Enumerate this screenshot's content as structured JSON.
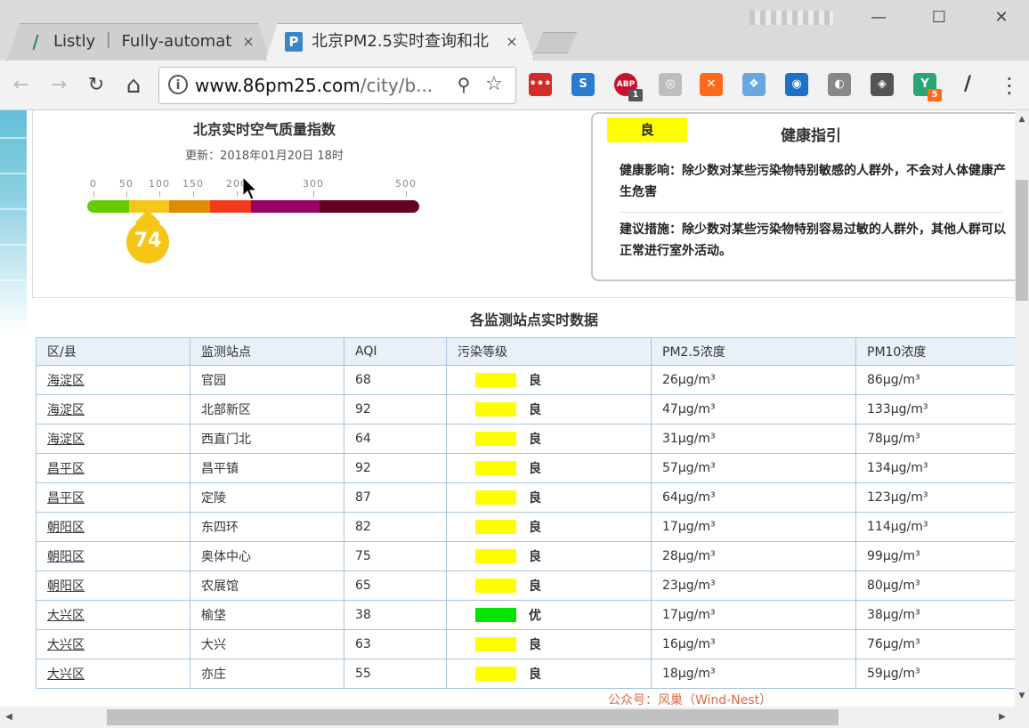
{
  "tabs": [
    {
      "title": "Listly ｜ Fully-automate",
      "favicon": "listly-icon",
      "close": "×"
    },
    {
      "title": "北京PM2.5实时查询和北",
      "favicon": "pm25-site-icon",
      "close": "×"
    }
  ],
  "window": {
    "minimize": "—",
    "maximize": "☐",
    "close": "✕"
  },
  "toolbar": {
    "back": "←",
    "forward": "→",
    "reload": "↻",
    "home": "⌂",
    "url_host": "www.86pm25.com",
    "url_path": "/city/b...",
    "info_icon": "i",
    "zoom_icon": "⚲",
    "bookmark_icon": "☆",
    "menu": "⋮",
    "extensions": [
      {
        "name": "lastpass-icon",
        "glyph": "•••",
        "color": "#d32d27",
        "badge": ""
      },
      {
        "name": "s-extension-icon",
        "glyph": "S",
        "color": "#2b7bd3",
        "badge": ""
      },
      {
        "name": "adblock-plus-icon",
        "glyph": "ABP",
        "color": "#c8102e",
        "badge": "1"
      },
      {
        "name": "weibo-icon",
        "glyph": "◎",
        "color": "#bdbdbd",
        "badge": ""
      },
      {
        "name": "tools-icon",
        "glyph": "✕",
        "color": "#ff6a1a",
        "badge": ""
      },
      {
        "name": "puzzle-icon",
        "glyph": "❖",
        "color": "#6aa6e0",
        "badge": ""
      },
      {
        "name": "circle-icon",
        "glyph": "◉",
        "color": "#1a73c9",
        "badge": ""
      },
      {
        "name": "moon-icon",
        "glyph": "◐",
        "color": "#888888",
        "badge": ""
      },
      {
        "name": "shield-dark-icon",
        "glyph": "◈",
        "color": "#555555",
        "badge": ""
      },
      {
        "name": "y-extension-icon",
        "glyph": "Y",
        "color": "#2aa676",
        "badge": "5"
      },
      {
        "name": "listly-ext-icon",
        "glyph": "/",
        "color": "#f2f2f2",
        "badge": ""
      }
    ]
  },
  "aqi": {
    "title": "北京实时空气质量指数",
    "updated": "更新：2018年01月20日 18时",
    "value": "74",
    "scale_ticks": [
      "0",
      "50",
      "100",
      "150",
      "200",
      "300",
      "500"
    ],
    "scale_colors": [
      "#66cc00",
      "#f5c518",
      "#e08a00",
      "#f23a1a",
      "#990066",
      "#660022"
    ]
  },
  "health": {
    "level": "良",
    "title": "健康指引",
    "impact": "健康影响：除少数对某些污染物特别敏感的人群外，不会对人体健康产生危害",
    "advice": "建议措施：除少数对某些污染物特别容易过敏的人群外，其他人群可以正常进行室外活动。"
  },
  "stations": {
    "title": "各监测站点实时数据",
    "headers": [
      "区/县",
      "监测站点",
      "AQI",
      "污染等级",
      "PM2.5浓度",
      "PM10浓度"
    ],
    "rows": [
      {
        "district": "海淀区",
        "station": "官园",
        "aqi": "68",
        "level": "良",
        "color": "#ffff00",
        "pm25": "26μg/m³",
        "pm10": "86μg/m³"
      },
      {
        "district": "海淀区",
        "station": "北部新区",
        "aqi": "92",
        "level": "良",
        "color": "#ffff00",
        "pm25": "47μg/m³",
        "pm10": "133μg/m³"
      },
      {
        "district": "海淀区",
        "station": "西直门北",
        "aqi": "64",
        "level": "良",
        "color": "#ffff00",
        "pm25": "31μg/m³",
        "pm10": "78μg/m³"
      },
      {
        "district": "昌平区",
        "station": "昌平镇",
        "aqi": "92",
        "level": "良",
        "color": "#ffff00",
        "pm25": "57μg/m³",
        "pm10": "134μg/m³"
      },
      {
        "district": "昌平区",
        "station": "定陵",
        "aqi": "87",
        "level": "良",
        "color": "#ffff00",
        "pm25": "64μg/m³",
        "pm10": "123μg/m³"
      },
      {
        "district": "朝阳区",
        "station": "东四环",
        "aqi": "82",
        "level": "良",
        "color": "#ffff00",
        "pm25": "17μg/m³",
        "pm10": "114μg/m³"
      },
      {
        "district": "朝阳区",
        "station": "奥体中心",
        "aqi": "75",
        "level": "良",
        "color": "#ffff00",
        "pm25": "28μg/m³",
        "pm10": "99μg/m³"
      },
      {
        "district": "朝阳区",
        "station": "农展馆",
        "aqi": "65",
        "level": "良",
        "color": "#ffff00",
        "pm25": "23μg/m³",
        "pm10": "80μg/m³"
      },
      {
        "district": "大兴区",
        "station": "榆垡",
        "aqi": "38",
        "level": "优",
        "color": "#00e400",
        "pm25": "17μg/m³",
        "pm10": "38μg/m³"
      },
      {
        "district": "大兴区",
        "station": "大兴",
        "aqi": "63",
        "level": "良",
        "color": "#ffff00",
        "pm25": "16μg/m³",
        "pm10": "76μg/m³"
      },
      {
        "district": "大兴区",
        "station": "亦庄",
        "aqi": "55",
        "level": "良",
        "color": "#ffff00",
        "pm25": "18μg/m³",
        "pm10": "59μg/m³"
      }
    ]
  },
  "watermark": "公众号：风巢（Wind-Nest）"
}
